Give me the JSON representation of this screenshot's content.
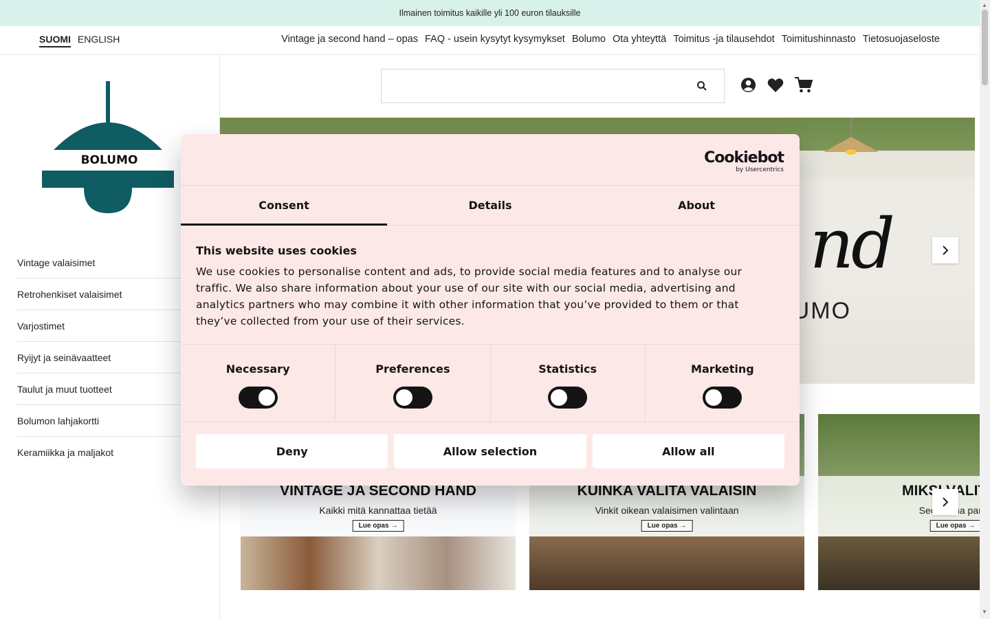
{
  "announcement": "Ilmainen toimitus kaikille yli 100 euron tilauksille",
  "languages": [
    {
      "label": "SUOMI",
      "active": true
    },
    {
      "label": "ENGLISH",
      "active": false
    }
  ],
  "nav_links": [
    "Vintage ja second hand – opas",
    "FAQ - usein kysytyt kysymykset",
    "Bolumo",
    "Ota yhteyttä",
    "Toimitus -ja tilausehdot",
    "Toimitushinnasto",
    "Tietosuojaseloste"
  ],
  "logo_text": "BOLUMO",
  "categories": [
    "Vintage valaisimet",
    "Retrohenkiset valaisimet",
    "Varjostimet",
    "Ryijyt ja seinävaatteet",
    "Taulut ja muut tuotteet",
    "Bolumon lahjakortti",
    "Keramiikka ja maljakot"
  ],
  "search": {
    "value": ""
  },
  "hero": {
    "script_text": "nd",
    "brand_text": "UMO"
  },
  "guides": [
    {
      "title": "VINTAGE JA SECOND HAND",
      "subtitle": "Kaikki mitä kannattaa tietää",
      "button": "Lue opas →"
    },
    {
      "title": "KUINKA VALITA VALAISIN",
      "subtitle": "Vinkit oikean valaisimen valintaan",
      "button": "Lue opas →"
    },
    {
      "title": "MIKSI VALITA V",
      "subtitle": "Second ha      parha",
      "button": "Lue opas →"
    }
  ],
  "cookie": {
    "logo_main": "Cookiebot",
    "logo_sub": "by Usercentrics",
    "tabs": [
      "Consent",
      "Details",
      "About"
    ],
    "title": "This website uses cookies",
    "body": "We use cookies to personalise content and ads, to provide social media features and to analyse our traffic. We also share information about your use of our site with our social media, advertising and analytics partners who may combine it with other information that you’ve provided to them or that they’ve collected from your use of their services.",
    "toggles": [
      {
        "label": "Necessary",
        "on": true
      },
      {
        "label": "Preferences",
        "on": false
      },
      {
        "label": "Statistics",
        "on": false
      },
      {
        "label": "Marketing",
        "on": false
      }
    ],
    "buttons": {
      "deny": "Deny",
      "allow_selection": "Allow selection",
      "allow_all": "Allow all"
    }
  },
  "colors": {
    "brand_teal": "#0f5c63",
    "announcement_bg": "#d8f1ea",
    "dialog_bg": "#fde8e8"
  }
}
